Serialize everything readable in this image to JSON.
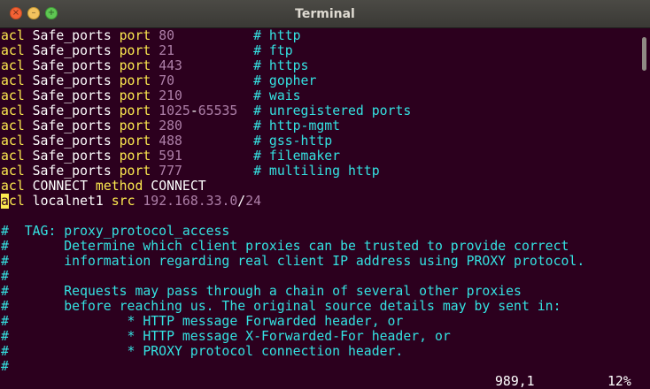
{
  "window": {
    "title": "Terminal"
  },
  "titlebar_buttons": {
    "close": "×",
    "minimize": "–",
    "maximize": "+"
  },
  "icons": {
    "close": "close-icon",
    "minimize": "minimize-icon",
    "maximize": "maximize-icon"
  },
  "colors": {
    "background": "#2c001e",
    "keyword": "#fce94f",
    "number": "#ad7fa8",
    "comment": "#34e2e2",
    "text": "#ffffff"
  },
  "lines": [
    [
      {
        "t": "acl",
        "c": "kw"
      },
      {
        "t": " Safe_ports ",
        "c": "id"
      },
      {
        "t": "port",
        "c": "kw"
      },
      {
        "t": " 80          ",
        "c": "num"
      },
      {
        "t": "# http",
        "c": "cmt"
      }
    ],
    [
      {
        "t": "acl",
        "c": "kw"
      },
      {
        "t": " Safe_ports ",
        "c": "id"
      },
      {
        "t": "port",
        "c": "kw"
      },
      {
        "t": " 21          ",
        "c": "num"
      },
      {
        "t": "# ftp",
        "c": "cmt"
      }
    ],
    [
      {
        "t": "acl",
        "c": "kw"
      },
      {
        "t": " Safe_ports ",
        "c": "id"
      },
      {
        "t": "port",
        "c": "kw"
      },
      {
        "t": " 443         ",
        "c": "num"
      },
      {
        "t": "# https",
        "c": "cmt"
      }
    ],
    [
      {
        "t": "acl",
        "c": "kw"
      },
      {
        "t": " Safe_ports ",
        "c": "id"
      },
      {
        "t": "port",
        "c": "kw"
      },
      {
        "t": " 70          ",
        "c": "num"
      },
      {
        "t": "# gopher",
        "c": "cmt"
      }
    ],
    [
      {
        "t": "acl",
        "c": "kw"
      },
      {
        "t": " Safe_ports ",
        "c": "id"
      },
      {
        "t": "port",
        "c": "kw"
      },
      {
        "t": " 210         ",
        "c": "num"
      },
      {
        "t": "# wais",
        "c": "cmt"
      }
    ],
    [
      {
        "t": "acl",
        "c": "kw"
      },
      {
        "t": " Safe_ports ",
        "c": "id"
      },
      {
        "t": "port",
        "c": "kw"
      },
      {
        "t": " 1025",
        "c": "num"
      },
      {
        "t": "-",
        "c": "id"
      },
      {
        "t": "65535  ",
        "c": "num"
      },
      {
        "t": "# unregistered ports",
        "c": "cmt"
      }
    ],
    [
      {
        "t": "acl",
        "c": "kw"
      },
      {
        "t": " Safe_ports ",
        "c": "id"
      },
      {
        "t": "port",
        "c": "kw"
      },
      {
        "t": " 280         ",
        "c": "num"
      },
      {
        "t": "# http-mgmt",
        "c": "cmt"
      }
    ],
    [
      {
        "t": "acl",
        "c": "kw"
      },
      {
        "t": " Safe_ports ",
        "c": "id"
      },
      {
        "t": "port",
        "c": "kw"
      },
      {
        "t": " 488         ",
        "c": "num"
      },
      {
        "t": "# gss-http",
        "c": "cmt"
      }
    ],
    [
      {
        "t": "acl",
        "c": "kw"
      },
      {
        "t": " Safe_ports ",
        "c": "id"
      },
      {
        "t": "port",
        "c": "kw"
      },
      {
        "t": " 591         ",
        "c": "num"
      },
      {
        "t": "# filemaker",
        "c": "cmt"
      }
    ],
    [
      {
        "t": "acl",
        "c": "kw"
      },
      {
        "t": " Safe_ports ",
        "c": "id"
      },
      {
        "t": "port",
        "c": "kw"
      },
      {
        "t": " 777         ",
        "c": "num"
      },
      {
        "t": "# multiling http",
        "c": "cmt"
      }
    ],
    [
      {
        "t": "acl",
        "c": "kw"
      },
      {
        "t": " CONNECT ",
        "c": "id"
      },
      {
        "t": "method",
        "c": "kw"
      },
      {
        "t": " CONNECT",
        "c": "id"
      }
    ],
    [
      {
        "t": "a",
        "c": "cursor"
      },
      {
        "t": "cl",
        "c": "kw"
      },
      {
        "t": " localnet1 ",
        "c": "id"
      },
      {
        "t": "src",
        "c": "kw"
      },
      {
        "t": " 192.168.33.0",
        "c": "num"
      },
      {
        "t": "/",
        "c": "id"
      },
      {
        "t": "24",
        "c": "num"
      }
    ],
    [],
    [
      {
        "t": "#  TAG: proxy_protocol_access",
        "c": "cmt"
      }
    ],
    [
      {
        "t": "#       Determine which client proxies can be trusted to provide correct",
        "c": "cmt"
      }
    ],
    [
      {
        "t": "#       information regarding real client IP address using PROXY protocol.",
        "c": "cmt"
      }
    ],
    [
      {
        "t": "#",
        "c": "cmt"
      }
    ],
    [
      {
        "t": "#       Requests may pass through a chain of several other proxies",
        "c": "cmt"
      }
    ],
    [
      {
        "t": "#       before reaching us. The original source details may by sent in:",
        "c": "cmt"
      }
    ],
    [
      {
        "t": "#               * HTTP message Forwarded header, or",
        "c": "cmt"
      }
    ],
    [
      {
        "t": "#               * HTTP message X-Forwarded-For header, or",
        "c": "cmt"
      }
    ],
    [
      {
        "t": "#               * PROXY protocol connection header.",
        "c": "cmt"
      }
    ],
    [
      {
        "t": "#",
        "c": "cmt"
      }
    ]
  ],
  "status": {
    "position": "989,1",
    "percent": "12%"
  }
}
